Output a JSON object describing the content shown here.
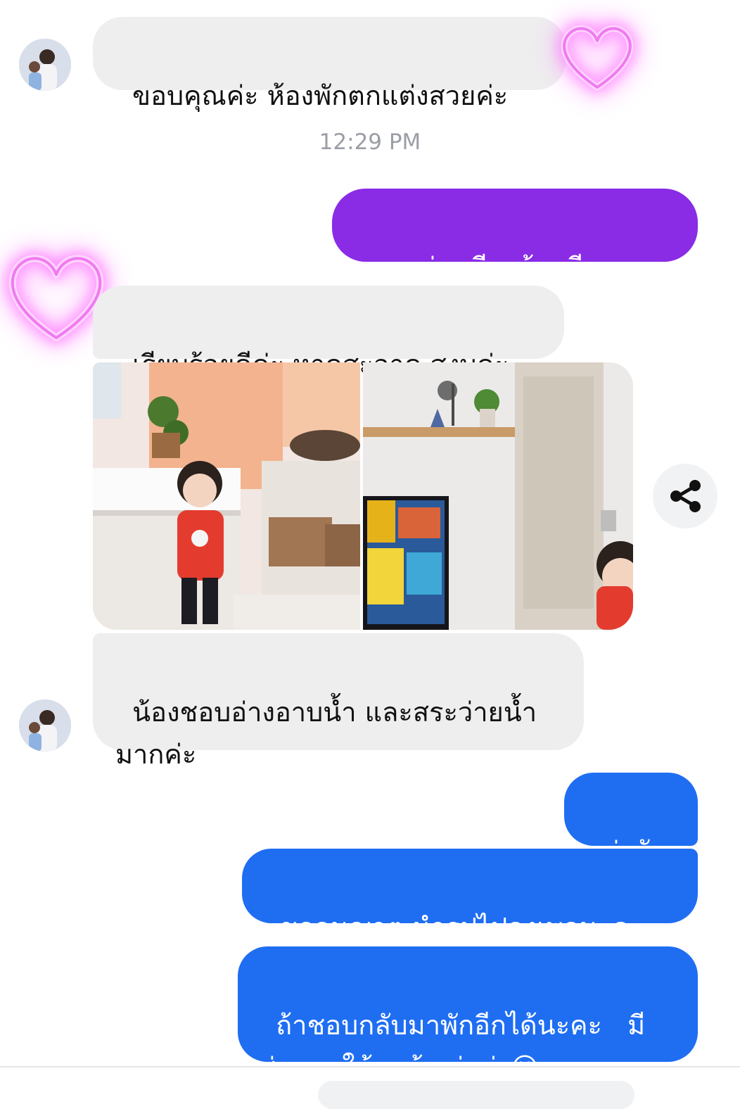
{
  "messages": [
    {
      "id": "m1",
      "direction": "incoming",
      "text": "ขอบคุณค่ะ ห้องพักตกแต่งสวยค่ะ"
    },
    {
      "id": "m2",
      "direction": "outgoing",
      "text": "ทุกอย่างเรียบร้อยดีนะคะ"
    },
    {
      "id": "m3",
      "direction": "incoming",
      "text": "เรียบร้อยดีค่ะ หาดสะอาด สงบค่ะ"
    },
    {
      "id": "m4",
      "direction": "incoming",
      "text": "น้องชอบอ่างอาบน้ำ และสระว่ายน้ำ\nมากค่ะ"
    },
    {
      "id": "m5",
      "direction": "outgoing",
      "text": "น่ารักก"
    },
    {
      "id": "m6",
      "direction": "outgoing",
      "text": "ขออนุญาต นำรูปไปลงเพจนะคะ"
    },
    {
      "id": "m7",
      "direction": "outgoing",
      "text": "ถ้าชอบกลับมาพักอีกได้นะคะ   มี\nส่วนลดให้ลูกค้าเก่าค่ะ😀"
    }
  ],
  "timestamp": "12:29 PM",
  "colors": {
    "incoming_bubble": "#eeeeef",
    "outgoing_purple": "#8a2be6",
    "outgoing_blue": "#1f6ef2",
    "heart_glow": "#ff5cff"
  },
  "icons": {
    "share": "share-icon",
    "heart": "heart-icon",
    "avatar": "avatar-photo"
  },
  "photos": [
    {
      "subject": "child-in-bathroom"
    },
    {
      "subject": "living-room-tv-shelf"
    }
  ]
}
